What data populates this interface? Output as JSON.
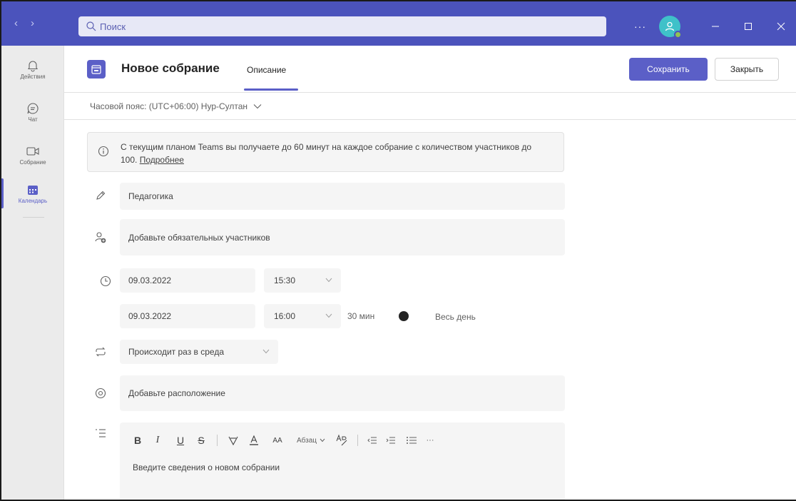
{
  "titlebar": {
    "search_placeholder": "Поиск",
    "more": "···"
  },
  "rail": {
    "items": [
      {
        "label": "Действия",
        "icon": "bell-icon"
      },
      {
        "label": "Чат",
        "icon": "chat-icon"
      },
      {
        "label": "Собрание",
        "icon": "video-icon"
      },
      {
        "label": "Календарь",
        "icon": "calendar-icon",
        "active": true
      }
    ]
  },
  "header": {
    "title": "Новое собрание",
    "tab": "Описание",
    "save": "Сохранить",
    "close": "Закрыть"
  },
  "timezone": {
    "label": "Часовой пояс: (UTC+06:00) Нур-Султан"
  },
  "banner": {
    "text": "С текущим планом Teams вы получаете до 60 минут на каждое собрание с количеством участников до 100.",
    "link": "Подробнее"
  },
  "form": {
    "title_value": "Педагогика",
    "attendees_placeholder": "Добавьте обязательных участников",
    "start_date": "09.03.2022",
    "start_time": "15:30",
    "end_date": "09.03.2022",
    "end_time": "16:00",
    "duration": "30 мин",
    "all_day_label": "Весь день",
    "all_day_on": false,
    "recurrence": "Происходит раз в среда",
    "location_placeholder": "Добавьте расположение",
    "details_placeholder": "Введите сведения о новом собрании"
  },
  "editor_toolbar": {
    "bold": "B",
    "italic": "I",
    "underline": "U",
    "strike": "S",
    "font_size": "AA",
    "paragraph": "Абзац",
    "more": "···"
  },
  "colors": {
    "accent": "#5b5fc7",
    "titlebar": "#4b53bc"
  }
}
